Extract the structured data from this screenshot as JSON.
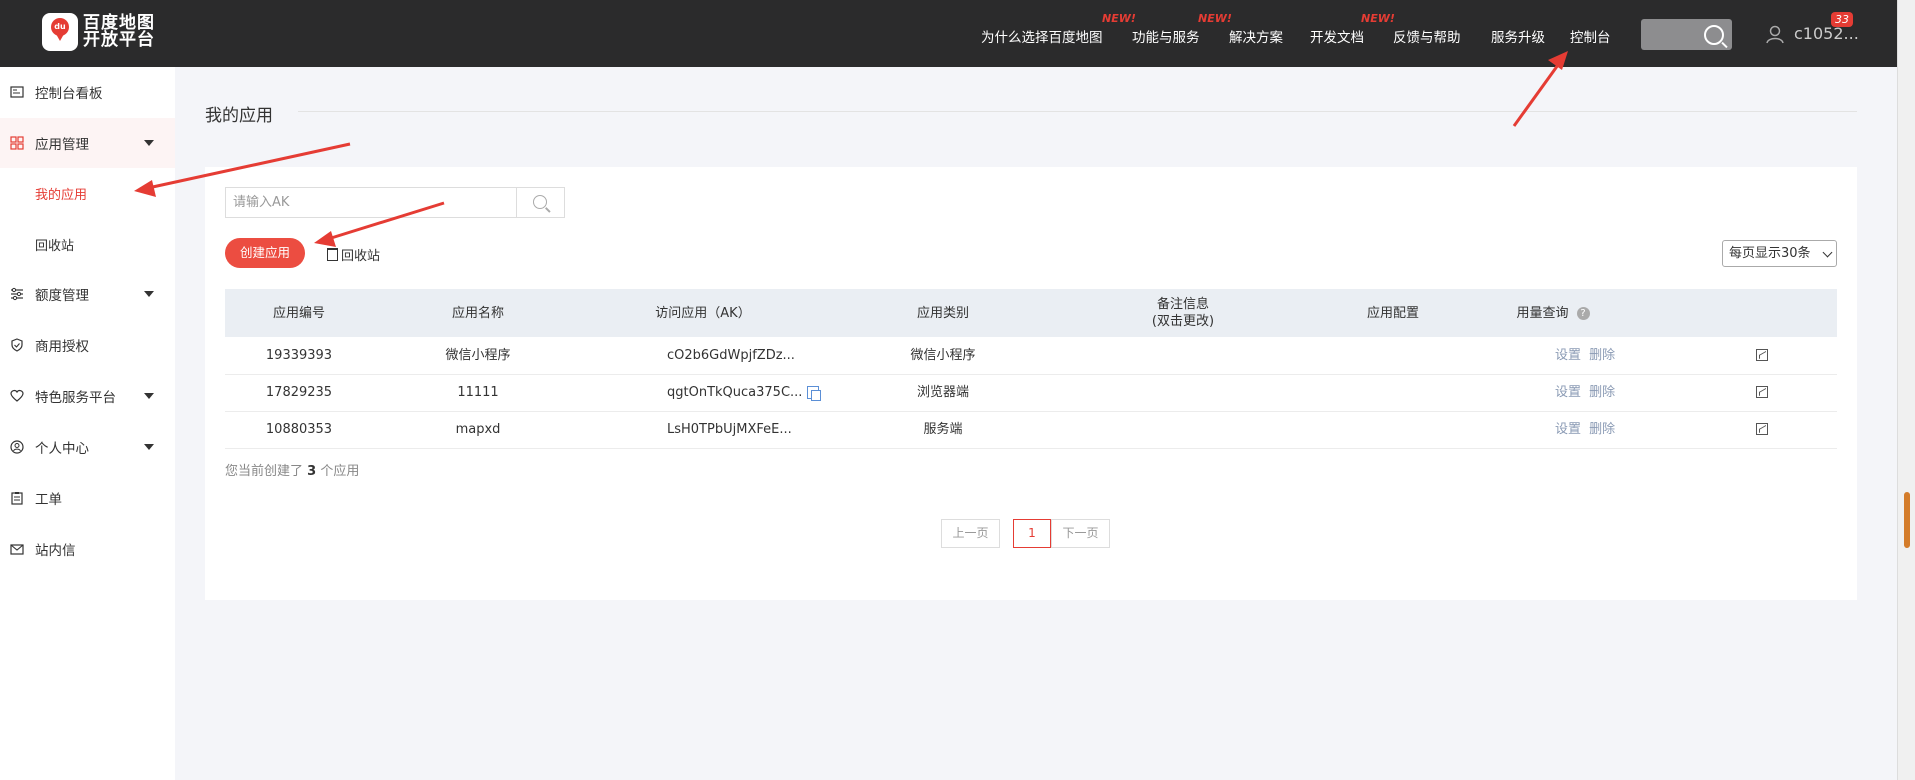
{
  "header": {
    "logo_text_line1": "百度地图",
    "logo_text_line2": "开放平台",
    "logo_pin": "du",
    "nav": [
      {
        "label": "为什么选择百度地图",
        "new": ""
      },
      {
        "label": "功能与服务",
        "new": "NEW!"
      },
      {
        "label": "解决方案",
        "new": "NEW!"
      },
      {
        "label": "开发文档",
        "new": "NEW!"
      },
      {
        "label": "反馈与帮助",
        "new": ""
      },
      {
        "label": "服务升级",
        "new": ""
      },
      {
        "label": "控制台",
        "new": ""
      }
    ],
    "user_name": "c1052...",
    "notification_count": "33"
  },
  "sidebar": {
    "items": [
      {
        "label": "控制台看板",
        "icon": "dashboard-icon"
      },
      {
        "label": "应用管理",
        "icon": "grid-icon"
      },
      {
        "label": "额度管理",
        "icon": "sliders-icon"
      },
      {
        "label": "商用授权",
        "icon": "shield-icon"
      },
      {
        "label": "特色服务平台",
        "icon": "heart-icon"
      },
      {
        "label": "个人中心",
        "icon": "user-icon"
      },
      {
        "label": "工单",
        "icon": "clipboard-icon"
      },
      {
        "label": "站内信",
        "icon": "mail-icon"
      }
    ],
    "sub_items": [
      {
        "label": "我的应用"
      },
      {
        "label": "回收站"
      }
    ]
  },
  "main": {
    "title": "我的应用",
    "search": {
      "placeholder": "请输入AK",
      "value": ""
    },
    "create_button": "创建应用",
    "recycle_link": "回收站",
    "page_size": "每页显示30条",
    "table": {
      "headers": [
        "应用编号",
        "应用名称",
        "访问应用（AK）",
        "应用类别",
        "备注信息",
        "(双击更改)",
        "应用配置",
        "用量查询"
      ],
      "rows": [
        {
          "id": "19339393",
          "name": "微信小程序",
          "ak": "cO2b6GdWpjfZDz...",
          "category": "微信小程序",
          "note": "",
          "set": "设置",
          "del": "删除"
        },
        {
          "id": "17829235",
          "name": "11111",
          "ak": "qgtOnTkQuca375C...",
          "category": "浏览器端",
          "note": "",
          "set": "设置",
          "del": "删除"
        },
        {
          "id": "10880353",
          "name": "mapxd",
          "ak": "LsH0TPbUjMXFeE...",
          "category": "服务端",
          "note": "",
          "set": "设置",
          "del": "删除"
        }
      ]
    },
    "summary": {
      "prefix": "您当前创建了",
      "count": "3",
      "suffix": "个应用"
    },
    "pagination": {
      "prev": "上一页",
      "current": "1",
      "next": "下一页"
    }
  },
  "colors": {
    "accent": "#e53c34",
    "header_bg": "#2b2b2c",
    "annotation_arrow": "#e53c34"
  }
}
